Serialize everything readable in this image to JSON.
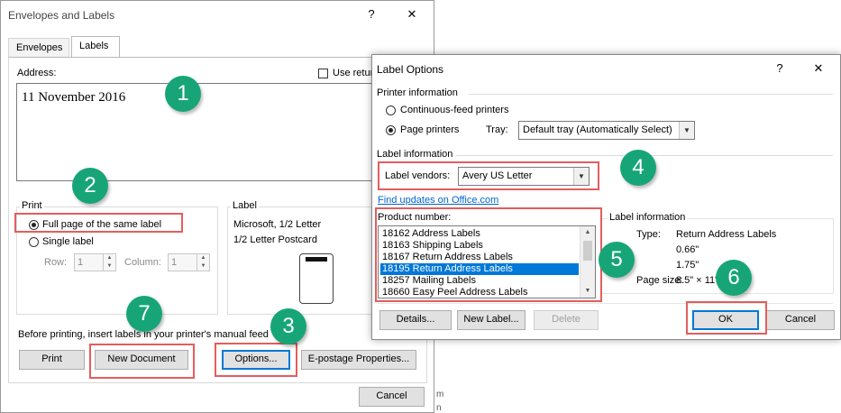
{
  "envelopes_dialog": {
    "title": "Envelopes and Labels",
    "help": "?",
    "close": "✕",
    "tabs": [
      "Envelopes",
      "Labels"
    ],
    "address_label": "Address:",
    "use_return_label": "Use retur",
    "address_value": "11 November 2016",
    "print_group": "Print",
    "full_page_label": "Full page of the same label",
    "single_label": "Single label",
    "row_label": "Row:",
    "row_value": "1",
    "column_label": "Column:",
    "column_value": "1",
    "label_group": "Label",
    "label_line1": "Microsoft, 1/2 Letter",
    "label_line2": "1/2 Letter Postcard",
    "before_printing": "Before printing, insert labels in your printer's manual feed",
    "print_btn": "Print",
    "new_document_btn": "New Document",
    "options_btn": "Options...",
    "epostage_btn": "E-postage Properties...",
    "cancel_btn": "Cancel"
  },
  "label_options_dialog": {
    "title": "Label Options",
    "help": "?",
    "close": "✕",
    "printer_info_header": "Printer information",
    "continuous_feed": "Continuous-feed printers",
    "page_printers": "Page printers",
    "tray_label": "Tray:",
    "tray_value": "Default tray (Automatically Select)",
    "label_info_header": "Label information",
    "label_vendors_label": "Label vendors:",
    "label_vendors_value": "Avery US Letter",
    "find_updates_link": "Find updates on Office.com",
    "product_number_label": "Product number:",
    "products": [
      "18162 Address Labels",
      "18163 Shipping Labels",
      "18167 Return Address Labels",
      "18195 Return Address Labels",
      "18257 Mailing Labels",
      "18660 Easy Peel Address Labels"
    ],
    "selected_product_index": 3,
    "label_info_panel_header": "Label information",
    "info_type_label": "Type:",
    "info_type_value": "Return Address Labels",
    "info_height_value": "0.66\"",
    "info_width_value": "1.75\"",
    "info_pagesize_label": "Page size:",
    "info_pagesize_value": "8.5\" × 11\"",
    "details_btn": "Details...",
    "new_label_btn": "New Label...",
    "delete_btn": "Delete",
    "ok_btn": "OK",
    "cancel_btn": "Cancel"
  },
  "callouts": [
    "1",
    "2",
    "3",
    "4",
    "5",
    "6",
    "7"
  ],
  "colors": {
    "callout_green": "#17a577",
    "highlight_red": "#e45d5d",
    "selection_blue": "#0078d7",
    "link_blue": "#0066cc"
  }
}
